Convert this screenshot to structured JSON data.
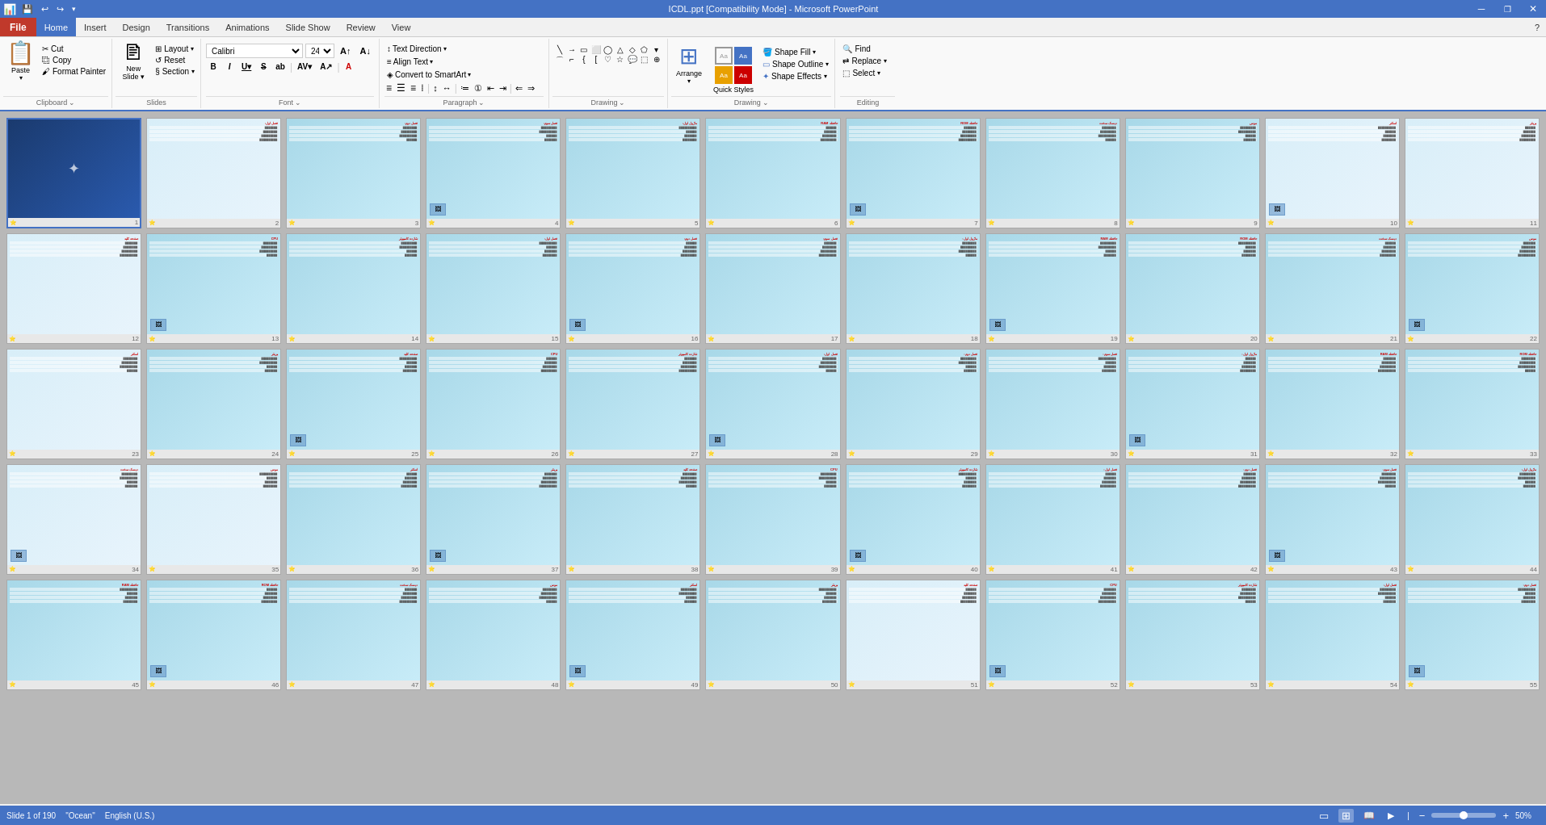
{
  "titleBar": {
    "title": "ICDL.ppt [Compatibility Mode] - Microsoft PowerPoint",
    "minimize": "─",
    "restore": "❐",
    "close": "✕"
  },
  "quickAccessToolbar": {
    "save": "💾",
    "undo": "↩",
    "redo": "↪",
    "more": "▾"
  },
  "menuBar": {
    "items": [
      "File",
      "Home",
      "Insert",
      "Design",
      "Transitions",
      "Animations",
      "Slide Show",
      "Review",
      "View"
    ],
    "activeIndex": 1
  },
  "ribbon": {
    "groups": [
      {
        "name": "Clipboard",
        "label": "Clipboard",
        "buttons": [
          "Paste",
          "Cut",
          "Copy",
          "Format Painter"
        ]
      },
      {
        "name": "Slides",
        "label": "Slides",
        "buttons": [
          "New Slide",
          "Layout",
          "Reset",
          "Section"
        ]
      },
      {
        "name": "Font",
        "label": "Font",
        "fontName": "Calibri",
        "fontSize": "24",
        "formatButtons": [
          "B",
          "I",
          "U",
          "S",
          "aa",
          "A↑",
          "A↓",
          "A"
        ]
      },
      {
        "name": "Paragraph",
        "label": "Paragraph",
        "textDirection": "Text Direction",
        "alignText": "Align Text",
        "convertToSmartArt": "Convert to SmartArt"
      },
      {
        "name": "Drawing",
        "label": "Drawing"
      },
      {
        "name": "QuickStyles",
        "label": "Quick Styles",
        "arrange": "Arrange",
        "quickStyles": "Quick Styles",
        "shapeFill": "Shape Fill",
        "shapeOutline": "Shape Outline",
        "shapeEffects": "Shape Effects"
      },
      {
        "name": "Editing",
        "label": "Editing",
        "find": "Find",
        "replace": "Replace",
        "select": "Select"
      }
    ]
  },
  "slides": [
    {
      "num": 1,
      "bg": "blue",
      "selected": true
    },
    {
      "num": 2,
      "bg": "light",
      "title": "شازده کامپیوتر"
    },
    {
      "num": 3,
      "bg": "teal"
    },
    {
      "num": 4,
      "bg": "teal"
    },
    {
      "num": 5,
      "bg": "teal"
    },
    {
      "num": 6,
      "bg": "teal"
    },
    {
      "num": 7,
      "bg": "teal"
    },
    {
      "num": 8,
      "bg": "teal"
    },
    {
      "num": 9,
      "bg": "teal"
    },
    {
      "num": 10,
      "bg": "light"
    },
    {
      "num": 11,
      "bg": "light"
    },
    {
      "num": 12,
      "bg": "light"
    },
    {
      "num": 13,
      "bg": "teal"
    },
    {
      "num": 14,
      "bg": "teal"
    },
    {
      "num": 15,
      "bg": "teal"
    },
    {
      "num": 16,
      "bg": "teal"
    },
    {
      "num": 17,
      "bg": "teal"
    },
    {
      "num": 18,
      "bg": "teal"
    },
    {
      "num": 19,
      "bg": "teal"
    },
    {
      "num": 20,
      "bg": "teal"
    },
    {
      "num": 21,
      "bg": "teal"
    },
    {
      "num": 22,
      "bg": "teal"
    },
    {
      "num": 23,
      "bg": "light"
    },
    {
      "num": 24,
      "bg": "teal"
    },
    {
      "num": 25,
      "bg": "teal"
    },
    {
      "num": 26,
      "bg": "teal"
    },
    {
      "num": 27,
      "bg": "teal"
    },
    {
      "num": 28,
      "bg": "teal"
    },
    {
      "num": 29,
      "bg": "teal"
    },
    {
      "num": 30,
      "bg": "teal"
    },
    {
      "num": 31,
      "bg": "teal"
    },
    {
      "num": 32,
      "bg": "teal"
    },
    {
      "num": 33,
      "bg": "teal"
    },
    {
      "num": 34,
      "bg": "light"
    },
    {
      "num": 35,
      "bg": "light"
    },
    {
      "num": 36,
      "bg": "teal"
    },
    {
      "num": 37,
      "bg": "teal"
    },
    {
      "num": 38,
      "bg": "teal"
    },
    {
      "num": 39,
      "bg": "teal"
    },
    {
      "num": 40,
      "bg": "teal"
    },
    {
      "num": 41,
      "bg": "teal"
    },
    {
      "num": 42,
      "bg": "teal"
    },
    {
      "num": 43,
      "bg": "teal"
    },
    {
      "num": 44,
      "bg": "teal"
    },
    {
      "num": 45,
      "bg": "teal"
    },
    {
      "num": 46,
      "bg": "teal"
    },
    {
      "num": 47,
      "bg": "teal"
    },
    {
      "num": 48,
      "bg": "teal"
    },
    {
      "num": 49,
      "bg": "teal"
    },
    {
      "num": 50,
      "bg": "teal"
    },
    {
      "num": 51,
      "bg": "light"
    },
    {
      "num": 52,
      "bg": "teal"
    },
    {
      "num": 53,
      "bg": "teal"
    },
    {
      "num": 54,
      "bg": "teal"
    },
    {
      "num": 55,
      "bg": "teal"
    }
  ],
  "statusBar": {
    "slideInfo": "Slide 1 of 190",
    "theme": "\"Ocean\"",
    "language": "English (U.S.)",
    "zoom": "50%",
    "normalView": "▭",
    "slidesorterView": "⊞",
    "readingView": "📖",
    "slideshowView": "▶"
  }
}
